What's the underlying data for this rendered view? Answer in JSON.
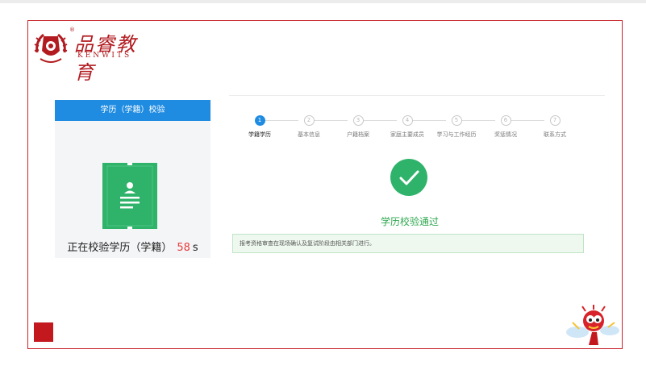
{
  "brand": {
    "name_cn": "品睿教育",
    "name_en": "KENWITS",
    "registered_mark": "®",
    "color": "#b21b20"
  },
  "left_panel": {
    "header": "学历（学籍）校验",
    "status_label": "正在校验学历（学籍）",
    "seconds": "58",
    "unit": "s",
    "icon": "document-icon"
  },
  "steps": [
    {
      "num": "1",
      "label": "学籍学历",
      "active": true
    },
    {
      "num": "2",
      "label": "基本信息",
      "active": false
    },
    {
      "num": "3",
      "label": "户籍档案",
      "active": false
    },
    {
      "num": "4",
      "label": "家庭主要成员",
      "active": false
    },
    {
      "num": "5",
      "label": "学习与工作经历",
      "active": false
    },
    {
      "num": "6",
      "label": "奖惩情况",
      "active": false
    },
    {
      "num": "7",
      "label": "联系方式",
      "active": false
    }
  ],
  "result": {
    "icon": "check-icon",
    "text": "学历校验通过",
    "color": "#2fa84f"
  },
  "notice": "报考资格审查在现场确认及复试阶段由相关部门进行。",
  "colors": {
    "accent": "#1f8ce2",
    "frame": "#c9242b",
    "success": "#2fa84f"
  }
}
